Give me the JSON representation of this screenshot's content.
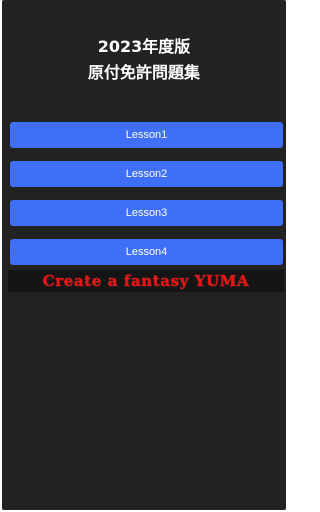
{
  "header": {
    "title_line1": "2023年度版",
    "title_line2": "原付免許問題集"
  },
  "lessons": [
    {
      "label": "Lesson1"
    },
    {
      "label": "Lesson2"
    },
    {
      "label": "Lesson3"
    },
    {
      "label": "Lesson4"
    }
  ],
  "banner": {
    "text": "Create a fantasy YUMA"
  },
  "colors": {
    "background": "#222222",
    "button": "#3f6ef7",
    "button_text": "#ffffff",
    "banner_text": "#e81414",
    "title_text": "#ffffff"
  }
}
